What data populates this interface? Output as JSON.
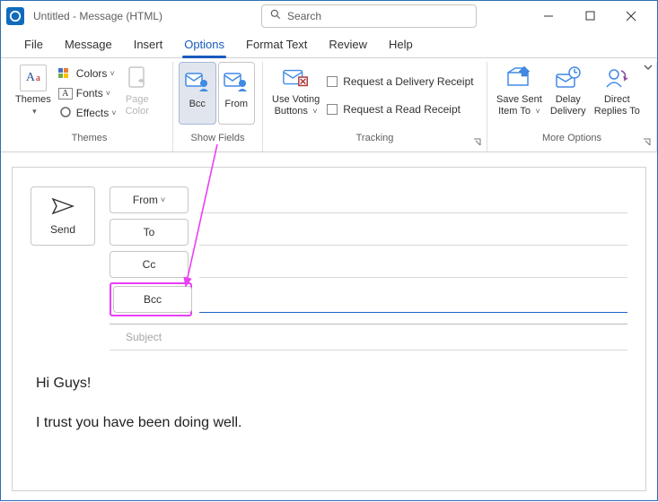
{
  "titlebar": {
    "title": "Untitled  -  Message (HTML)",
    "search_placeholder": "Search"
  },
  "menu": {
    "items": [
      "File",
      "Message",
      "Insert",
      "Options",
      "Format Text",
      "Review",
      "Help"
    ],
    "active_index": 3
  },
  "ribbon": {
    "themes": {
      "label": "Themes",
      "themes_btn": "Themes",
      "colors": "Colors",
      "fonts": "Fonts",
      "effects": "Effects",
      "page_color": "Page\nColor"
    },
    "showfields": {
      "label": "Show Fields",
      "bcc": "Bcc",
      "from": "From"
    },
    "tracking": {
      "label": "Tracking",
      "voting": "Use Voting\nButtons",
      "delivery_receipt": "Request a Delivery Receipt",
      "read_receipt": "Request a Read Receipt"
    },
    "more": {
      "label": "More Options",
      "save_sent": "Save Sent\nItem To",
      "delay": "Delay\nDelivery",
      "direct": "Direct\nReplies To"
    }
  },
  "compose": {
    "send": "Send",
    "from": "From",
    "to": "To",
    "cc": "Cc",
    "bcc": "Bcc",
    "subject_placeholder": "Subject",
    "body_lines": [
      "Hi Guys!",
      "I trust you have been doing well."
    ]
  }
}
